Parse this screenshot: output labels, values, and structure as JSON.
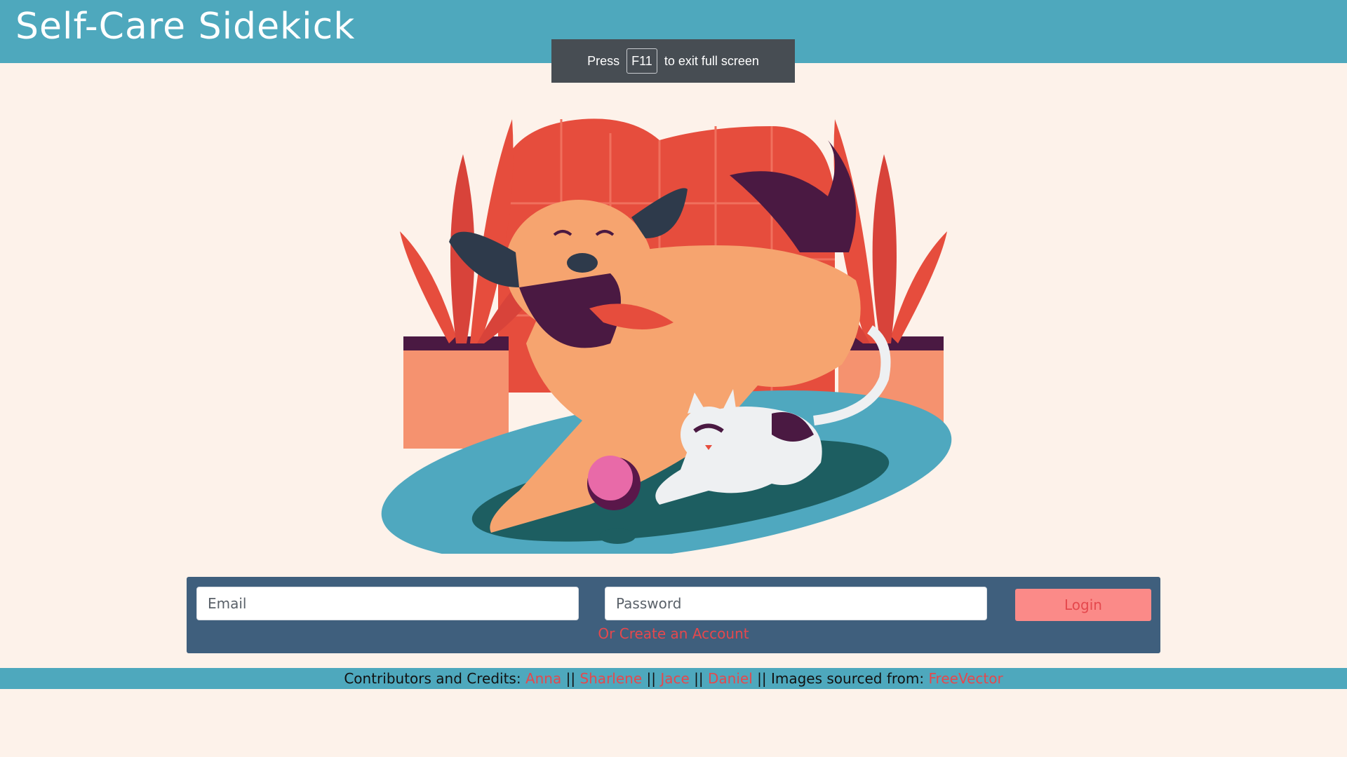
{
  "header": {
    "title": "Self-Care Sidekick",
    "bg_color": "#4ea8bd"
  },
  "fullscreen_toast": {
    "press": "Press",
    "key": "F11",
    "rest": "to exit full screen"
  },
  "hero": {
    "icon": "dog-and-cat-playing-illustration"
  },
  "login": {
    "email_placeholder": "Email",
    "password_placeholder": "Password",
    "button_label": "Login",
    "create_account_label": "Or Create an Account",
    "panel_color": "#3f5f7d",
    "button_color": "#fb8a88",
    "accent_color": "#e5484d"
  },
  "footer": {
    "prefix": "Contributors and Credits:",
    "contributors": [
      "Anna",
      "Sharlene",
      "Jace",
      "Daniel"
    ],
    "separator": "||",
    "images_label": "Images sourced from:",
    "images_source": "FreeVector"
  }
}
